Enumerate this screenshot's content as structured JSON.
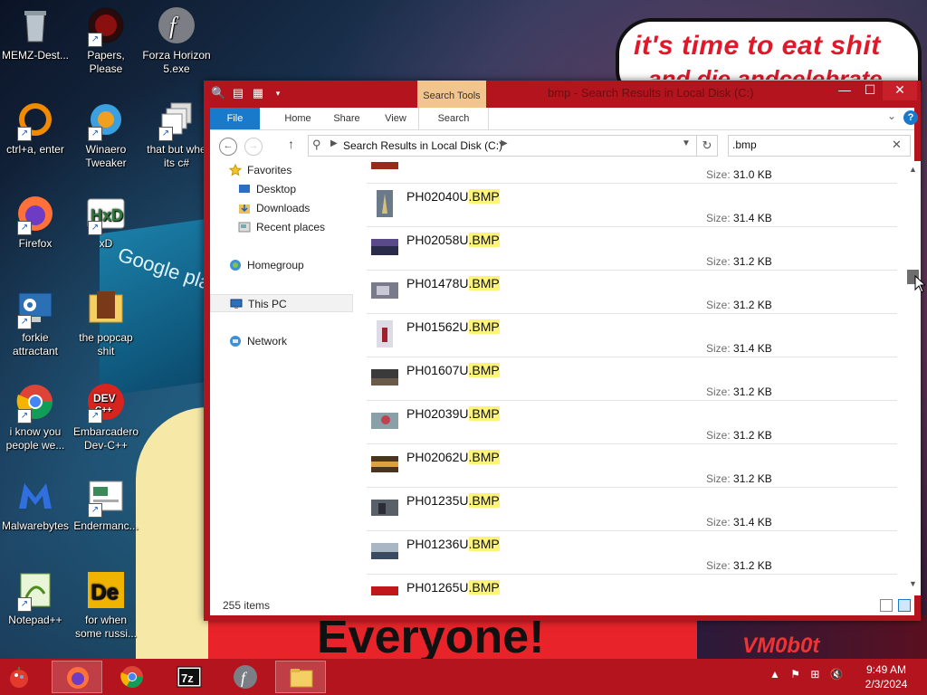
{
  "wallpaper": {
    "speech_text": "it's time to eat shit",
    "speech_text2": "and die andcelebrate",
    "bottom_text": "Everyone!",
    "google_play_text": "Google play",
    "vm_text": "VM0b0t"
  },
  "desktop_icons": [
    {
      "label": "MEMZ-Dest...",
      "icon": "recycle-bin-icon"
    },
    {
      "label": "Papers, Please",
      "icon": "papers-please-icon"
    },
    {
      "label": "Forza Horizon 5.exe",
      "icon": "flash-icon"
    },
    {
      "label": "ctrl+a, enter",
      "icon": "ring-icon"
    },
    {
      "label": "Winaero Tweaker",
      "icon": "winaero-icon"
    },
    {
      "label": "that but whe its c#",
      "icon": "stack-icon"
    },
    {
      "label": "Firefox",
      "icon": "firefox-icon"
    },
    {
      "label": "xD",
      "icon": "hxd-icon"
    },
    {
      "label": "forkie attractant",
      "icon": "settings-monitor-icon"
    },
    {
      "label": "the popcap shit",
      "icon": "popcap-folder-icon"
    },
    {
      "label": "i know you people we...",
      "icon": "chrome-icon"
    },
    {
      "label": "Embarcadero Dev-C++",
      "icon": "devcpp-icon"
    },
    {
      "label": "Malwarebytes",
      "icon": "malwarebytes-icon"
    },
    {
      "label": "Endermanc...",
      "icon": "endermanch-icon"
    },
    {
      "label": "Notepad++",
      "icon": "notepad-plus-icon"
    },
    {
      "label": "for when some russi...",
      "icon": "de-icon"
    }
  ],
  "window": {
    "title": "bmp - Search Results in Local Disk (C:)",
    "context_tab": "Search Tools",
    "ribbon_tabs": {
      "file": "File",
      "home": "Home",
      "share": "Share",
      "view": "View",
      "search": "Search"
    },
    "address": {
      "location": "Search Results in Local Disk (C:)"
    },
    "search": {
      "value": ".bmp"
    },
    "nav_pane": {
      "favorites": "Favorites",
      "desktop": "Desktop",
      "downloads": "Downloads",
      "recent": "Recent places",
      "homegroup": "Homegroup",
      "this_pc": "This PC",
      "network": "Network"
    },
    "partial_top_size": {
      "label": "Size:",
      "value": "31.0 KB"
    },
    "files": [
      {
        "name": "PH02040U",
        "ext": ".BMP",
        "size_label": "Size:",
        "size": "31.4 KB"
      },
      {
        "name": "PH02058U",
        "ext": ".BMP",
        "size_label": "Size:",
        "size": "31.2 KB"
      },
      {
        "name": "PH01478U",
        "ext": ".BMP",
        "size_label": "Size:",
        "size": "31.2 KB"
      },
      {
        "name": "PH01562U",
        "ext": ".BMP",
        "size_label": "Size:",
        "size": "31.4 KB"
      },
      {
        "name": "PH01607U",
        "ext": ".BMP",
        "size_label": "Size:",
        "size": "31.2 KB"
      },
      {
        "name": "PH02039U",
        "ext": ".BMP",
        "size_label": "Size:",
        "size": "31.2 KB"
      },
      {
        "name": "PH02062U",
        "ext": ".BMP",
        "size_label": "Size:",
        "size": "31.2 KB"
      },
      {
        "name": "PH01235U",
        "ext": ".BMP",
        "size_label": "Size:",
        "size": "31.4 KB"
      },
      {
        "name": "PH01236U",
        "ext": ".BMP",
        "size_label": "Size:",
        "size": "31.2 KB"
      },
      {
        "name": "PH01265U",
        "ext": ".BMP",
        "size_label": "Size:",
        "size": ""
      }
    ],
    "status": {
      "item_count": "255 items"
    }
  },
  "taskbar": {
    "clock_time": "9:49 AM",
    "clock_date": "2/3/2024",
    "seven_zip_label": "7z"
  },
  "colors": {
    "accent": "#b3141d",
    "file_tab": "#1979ca",
    "highlight": "#fdf27a"
  }
}
